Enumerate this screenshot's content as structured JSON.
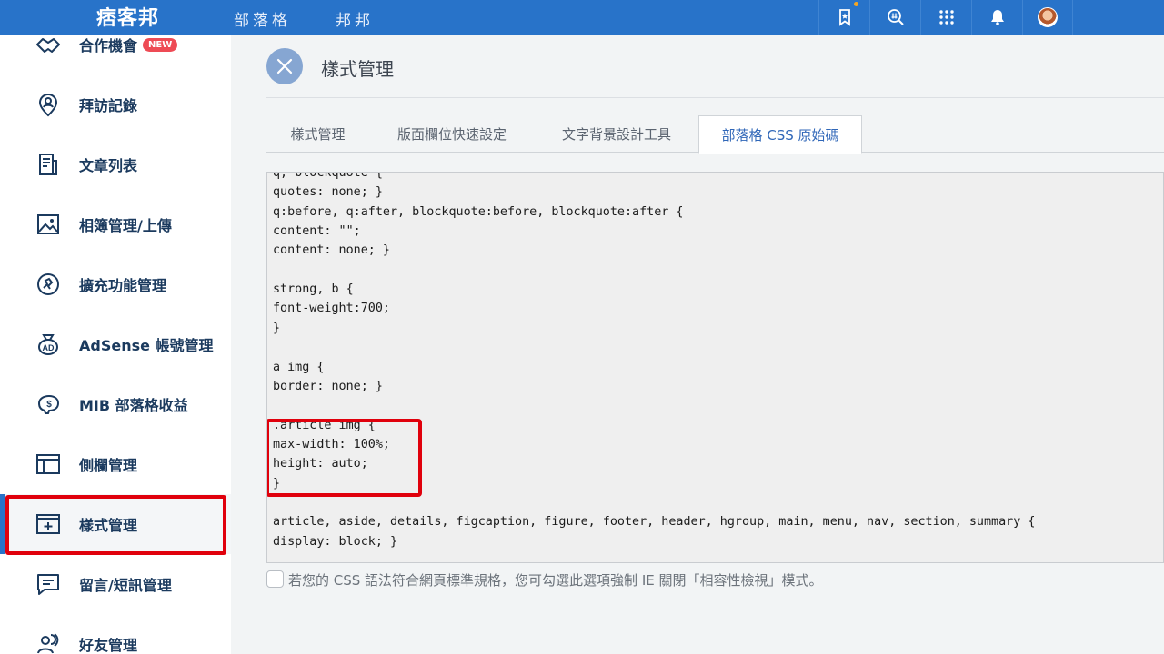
{
  "topbar": {
    "logo": "痞客邦",
    "nav": [
      "部落格",
      "邦邦"
    ]
  },
  "sidebar": {
    "items": [
      {
        "label": "合作機會",
        "icon": "handshake-icon",
        "badge": "NEW"
      },
      {
        "label": "拜訪記錄",
        "icon": "location-person-icon"
      },
      {
        "label": "文章列表",
        "icon": "document-list-icon"
      },
      {
        "label": "相簿管理/上傳",
        "icon": "photo-album-icon"
      },
      {
        "label": "擴充功能管理",
        "icon": "extension-icon"
      },
      {
        "label": "AdSense 帳號管理",
        "icon": "adsense-bag-icon"
      },
      {
        "label": "MIB 部落格收益",
        "icon": "piggy-bank-icon"
      },
      {
        "label": "側欄管理",
        "icon": "sidebar-layout-icon"
      },
      {
        "label": "樣式管理",
        "icon": "style-box-icon",
        "active": true
      },
      {
        "label": "留言/短訊管理",
        "icon": "message-icon"
      },
      {
        "label": "好友管理",
        "icon": "friends-icon"
      }
    ]
  },
  "main": {
    "title": "樣式管理",
    "tabs": [
      "樣式管理",
      "版面欄位快速設定",
      "文字背景設計工具",
      "部落格 CSS 原始碼"
    ],
    "active_tab": 3,
    "code_lines": [
      "q, blockquote {",
      "quotes: none; }",
      "q:before, q:after, blockquote:before, blockquote:after {",
      "content: \"\";",
      "content: none; }",
      "",
      "strong, b {",
      "font-weight:700;",
      "}",
      "",
      "a img {",
      "border: none; }",
      "",
      ".article img {",
      "max-width: 100%;",
      "height: auto;",
      "}",
      "",
      "article, aside, details, figcaption, figure, footer, header, hgroup, main, menu, nav, section, summary {",
      "display: block; }"
    ],
    "checkbox_label": "若您的 CSS 語法符合網頁標準規格，您可勾選此選項強制 IE 關閉「相容性檢視」模式。",
    "checkbox_checked": false
  },
  "colors": {
    "topbar": "#2873c9",
    "highlight": "#e0000c",
    "active_tab_text": "#3067b8"
  }
}
